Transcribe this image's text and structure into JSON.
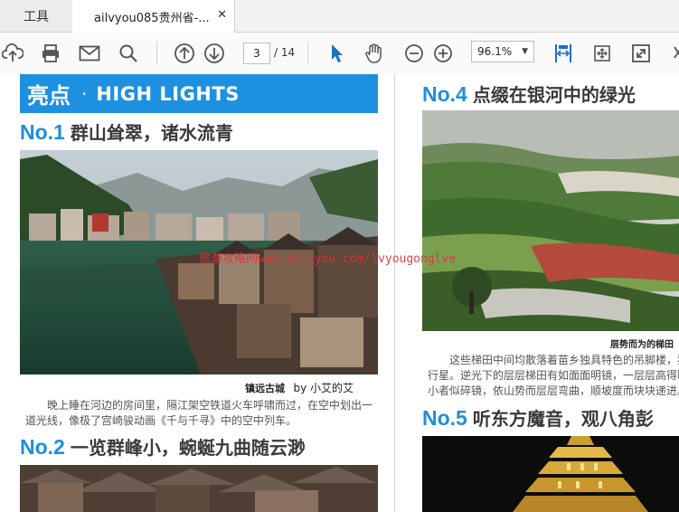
{
  "tabs": {
    "tools_label": "工具",
    "doc_label": "ailvyou085贵州省-...",
    "close_glyph": "✕"
  },
  "toolbar": {
    "current_page": "3",
    "total_pages": "/ 14",
    "zoom": "96.1%"
  },
  "document": {
    "highlight_cn": "亮点",
    "highlight_dot": "·",
    "highlight_en": "HIGH LIGHTS",
    "sections": [
      {
        "no": "No.1",
        "title": "群山耸翠，诸水流青"
      },
      {
        "no": "No.2",
        "title": "一览群峰小，蜿蜒九曲随云渺"
      },
      {
        "no": "No.4",
        "title": "点缀在银河中的绿光"
      },
      {
        "no": "No.5",
        "title": "听东方魔音，观八角彭"
      }
    ],
    "caption1_bold": "镇远古城",
    "caption1_by": "by 小艾的艾",
    "body1_line1": "晚上睡在河边的房间里，隔江架空铁道火车呼啸而过，在空中划出一",
    "body1_line2": "道光线，像极了宫崎骏动画《千与千寻》中的空中列车。",
    "caption4_bold": "层势而为的梯田",
    "body4_line1": "这些梯田中间均散落着苗乡独具特色的吊脚楼，犹",
    "body4_line2": "行星。逆光下的层层梯田有如面面明镜，一层层高得聊",
    "body4_line3": "小者似碎镜，依山势而层层弯曲，顺坡度而块块递进。",
    "watermark": "旅游攻略网www.ailvyou.com/lvyougonglve"
  }
}
